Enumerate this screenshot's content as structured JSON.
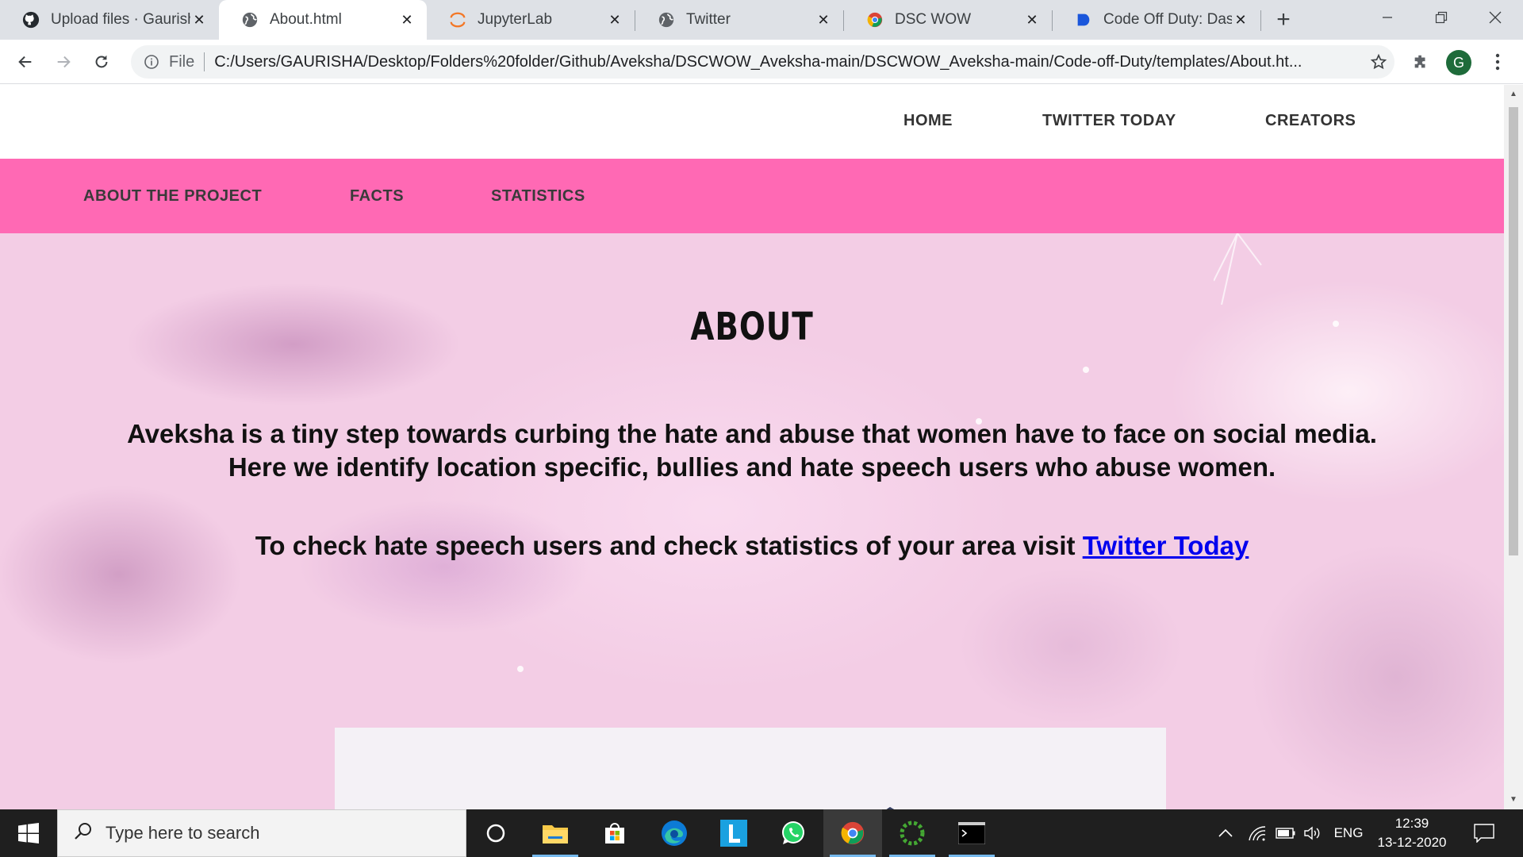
{
  "browser": {
    "tabs": [
      {
        "title": "Upload files · Gaurish",
        "favicon": "github-icon"
      },
      {
        "title": "About.html",
        "favicon": "globe-icon"
      },
      {
        "title": "JupyterLab",
        "favicon": "jupyter-icon"
      },
      {
        "title": "Twitter",
        "favicon": "globe-icon"
      },
      {
        "title": "DSC WOW",
        "favicon": "chrome-icon"
      },
      {
        "title": "Code Off Duty: Dash",
        "favicon": "docs-icon"
      }
    ],
    "scheme": "File",
    "url": "C:/Users/GAURISHA/Desktop/Folders%20folder/Github/Aveksha/DSCWOW_Aveksha-main/DSCWOW_Aveksha-main/Code-off-Duty/templates/About.ht...",
    "profile_initial": "G"
  },
  "page": {
    "nav": {
      "home": "HOME",
      "twitter_today": "TWITTER TODAY",
      "creators": "CREATORS"
    },
    "subnav": {
      "about_project": "ABOUT THE PROJECT",
      "facts": "FACTS",
      "statistics": "STATISTICS"
    },
    "heading": "ABOUT",
    "intro_line1": "Aveksha is a tiny step towards curbing the hate and abuse that women have to face on social media.",
    "intro_line2": "Here we identify location specific, bullies and hate speech users who abuse women.",
    "cta_text": "To check hate speech users and check statistics of your area visit ",
    "cta_link": "Twitter Today",
    "colors": {
      "subnav_bg": "#ff69b4",
      "hero_bg": "#f3cde5",
      "link": "#0000ee",
      "twitter_blue": "#2d9ff0",
      "mountain": "#2b3352"
    }
  },
  "taskbar": {
    "search_placeholder": "Type here to search",
    "language": "ENG",
    "time": "12:39",
    "date": "13-12-2020"
  }
}
